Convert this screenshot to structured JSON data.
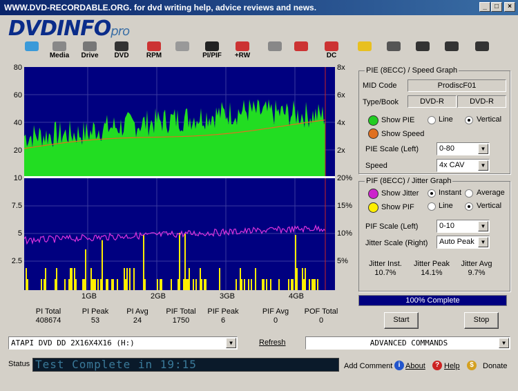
{
  "window": {
    "title": "WWW.DVD-RECORDABLE.ORG.   for dvd writing help, advice reviews and news.",
    "min": "_",
    "max": "□",
    "close": "×"
  },
  "logo": {
    "main": "DVDINFO",
    "sub": "pro"
  },
  "toolbar": [
    {
      "label": "",
      "icon": "monitor-icon",
      "color": "#3a9ad9"
    },
    {
      "label": "Media",
      "icon": "media-icon",
      "color": "#888"
    },
    {
      "label": "Drive",
      "icon": "drive-icon",
      "color": "#777"
    },
    {
      "label": "DVD",
      "icon": "dvd-icon",
      "color": "#333"
    },
    {
      "label": "RPM",
      "icon": "rpm-icon",
      "color": "#c33"
    },
    {
      "label": "",
      "icon": "magnifier-icon",
      "color": "#999"
    },
    {
      "label": "PI/PIF",
      "icon": "pipif-icon",
      "color": "#222"
    },
    {
      "label": "+RW",
      "icon": "rw-icon",
      "color": "#c33"
    },
    {
      "label": "",
      "icon": "eject-icon",
      "color": "#888"
    },
    {
      "label": "",
      "icon": "wave-icon",
      "color": "#c33"
    },
    {
      "label": "DC",
      "icon": "dc-icon",
      "color": "#c33"
    },
    {
      "label": "",
      "icon": "clipboard-icon",
      "color": "#e8c020"
    },
    {
      "label": "",
      "icon": "camera-icon",
      "color": "#555"
    },
    {
      "label": "",
      "icon": "notes-icon",
      "color": "#333"
    },
    {
      "label": "",
      "icon": "play-pause-icon",
      "color": "#333"
    },
    {
      "label": "",
      "icon": "stop-icon",
      "color": "#333"
    }
  ],
  "pie_graph": {
    "left_ticks": [
      "80",
      "60",
      "40",
      "20"
    ],
    "right_ticks": [
      "8x",
      "6x",
      "4x",
      "2x"
    ]
  },
  "pif_graph": {
    "left_ticks": [
      "10",
      "7.5",
      "5",
      "2.5"
    ],
    "right_ticks": [
      "20%",
      "15%",
      "10%",
      "5%"
    ],
    "x_ticks": [
      "1GB",
      "2GB",
      "3GB",
      "4GB"
    ]
  },
  "stats": [
    {
      "label": "PI Total",
      "value": "408674"
    },
    {
      "label": "PI Peak",
      "value": "53"
    },
    {
      "label": "PI Avg",
      "value": "24"
    },
    {
      "label": "PIF Total",
      "value": "1750"
    },
    {
      "label": "PIF Peak",
      "value": "6"
    },
    {
      "label": "PIF Avg",
      "value": "0"
    },
    {
      "label": "POF Total",
      "value": "0"
    }
  ],
  "pie_box": {
    "caption": "PIE (8ECC) / Speed Graph",
    "mid_label": "MID Code",
    "mid_value": "ProdiscF01",
    "type_label": "Type/Book",
    "type_value": "DVD-R",
    "book_value": "DVD-R",
    "show_pie": "Show PIE",
    "show_speed": "Show Speed",
    "line": "Line",
    "vertical": "Vertical",
    "pie_scale_label": "PIE Scale (Left)",
    "pie_scale_value": "0-80",
    "speed_label": "Speed",
    "speed_value": "4x CAV",
    "pie_color": "#22cc22",
    "speed_color": "#e07020"
  },
  "pif_box": {
    "caption": "PIF (8ECC) / Jitter Graph",
    "show_jitter": "Show Jitter",
    "instant": "Instant",
    "average": "Average",
    "show_pif": "Show PIF",
    "line": "Line",
    "vertical": "Vertical",
    "pif_scale_label": "PIF Scale (Left)",
    "pif_scale_value": "0-10",
    "jitter_scale_label": "Jitter Scale (Right)",
    "jitter_scale_value": "Auto Peak",
    "jitter_inst_label": "Jitter Inst.",
    "jitter_inst_value": "10.7%",
    "jitter_peak_label": "Jitter Peak",
    "jitter_peak_value": "14.1%",
    "jitter_avg_label": "Jitter Avg",
    "jitter_avg_value": "9.7%",
    "jitter_color": "#cc22cc",
    "pif_color": "#ffee00"
  },
  "progress": {
    "label": "100% Complete",
    "percent": 100
  },
  "buttons": {
    "start": "Start",
    "stop": "Stop",
    "refresh": "Refresh"
  },
  "drive_select": "ATAPI   DVD DD 2X16X4X16 (H:)",
  "advanced_select": "ADVANCED COMMANDS",
  "status": {
    "label": "Status",
    "text": "Test Complete in 19:15"
  },
  "footer": {
    "add_comment": "Add Comment",
    "about": "About",
    "help": "Help",
    "donate": "Donate"
  }
}
